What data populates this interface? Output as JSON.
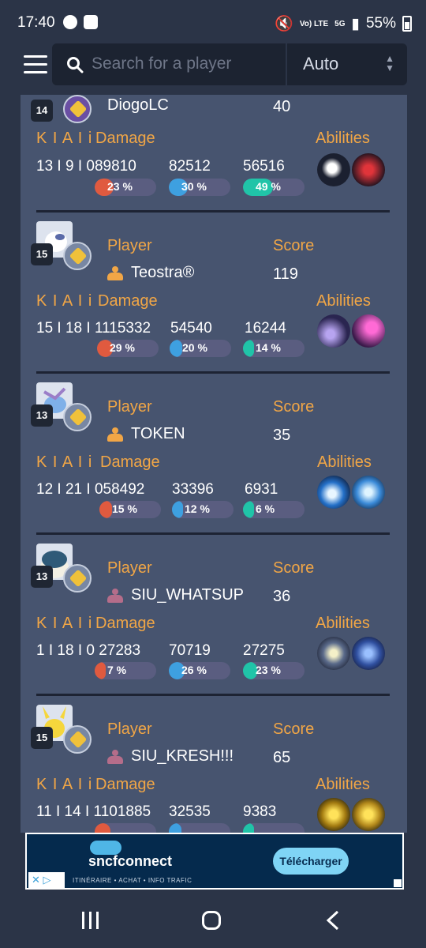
{
  "status": {
    "time": "17:40",
    "battery": "55%",
    "net": "5G",
    "volte": "Vo) LTE"
  },
  "search": {
    "placeholder": "Search for a player"
  },
  "select": {
    "value": "Auto"
  },
  "headers": {
    "player": "Player",
    "score": "Score",
    "kda": "K I A I i",
    "damage": "Damage",
    "abilities": "Abilities"
  },
  "players": [
    {
      "level": "14",
      "name": "DiogoLC",
      "score": "40",
      "team": "none",
      "kda": "13 I 9 I 0",
      "damage": "89810",
      "dmg2": "82512",
      "dmg3": "56516",
      "pct": [
        "23 %",
        "30 %",
        "49 %"
      ],
      "pct_values": [
        23,
        30,
        49
      ],
      "abilities": [
        "water-spout-icon",
        "red-slash-icon"
      ]
    },
    {
      "level": "15",
      "name": "Teostra®",
      "score": "119",
      "team": "orange",
      "kda": "15 I 18 I 1",
      "damage": "115332",
      "dmg2": "54540",
      "dmg3": "16244",
      "pct": [
        "29 %",
        "20 %",
        "14 %"
      ],
      "pct_values": [
        29,
        20,
        14
      ],
      "abilities": [
        "shadow-claw-icon",
        "psycho-cut-icon"
      ]
    },
    {
      "level": "13",
      "name": "TOKEN",
      "score": "35",
      "team": "orange",
      "kda": "12 I 21 I 0",
      "damage": "58492",
      "dmg2": "33396",
      "dmg3": "6931",
      "pct": [
        "15 %",
        "12 %",
        "6 %"
      ],
      "pct_values": [
        15,
        12,
        6
      ],
      "abilities": [
        "surf-icon",
        "ice-beam-icon"
      ]
    },
    {
      "level": "13",
      "name": "SIU_WHATSUP",
      "score": "36",
      "team": "purple",
      "kda": "1 I 18 I 0",
      "damage": "27283",
      "dmg2": "70719",
      "dmg3": "27275",
      "pct": [
        "7 %",
        "26 %",
        "23 %"
      ],
      "pct_values": [
        7,
        26,
        23
      ],
      "abilities": [
        "block-icon",
        "yawn-icon"
      ]
    },
    {
      "level": "15",
      "name": "SIU_KRESH!!!",
      "score": "65",
      "team": "purple",
      "kda": "11 I 14 I 1",
      "damage": "101885",
      "dmg2": "32535",
      "dmg3": "9383",
      "pct": [
        "",
        "",
        ""
      ],
      "pct_values": [
        26,
        10,
        3
      ],
      "abilities": [
        "thunder-icon",
        "thunderbolt-icon"
      ]
    }
  ],
  "colors": {
    "bar1": "#e05a3f",
    "bar2": "#3ea0e0",
    "bar3": "#20c4a8",
    "accent": "#f1a646",
    "orange_team": "#f1a646",
    "purple_team": "#b56d8a"
  },
  "ad": {
    "brand": "sncfconnect",
    "cta": "Télécharger",
    "tagline": "ITINÉRAIRE • ACHAT • INFO TRAFIC"
  }
}
